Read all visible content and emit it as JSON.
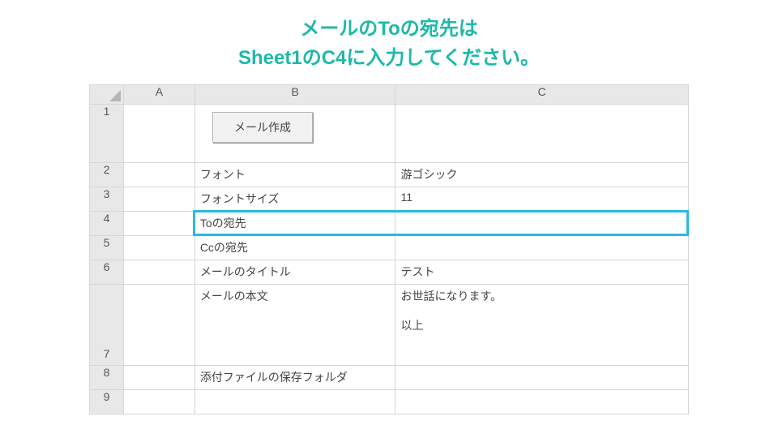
{
  "heading": {
    "line1": "メールのToの宛先は",
    "line2": "Sheet1のC4に入力してください。"
  },
  "colHeaders": {
    "A": "A",
    "B": "B",
    "C": "C"
  },
  "rowHeaders": [
    "1",
    "2",
    "3",
    "4",
    "5",
    "6",
    "7",
    "8",
    "9"
  ],
  "button": {
    "label": "メール作成"
  },
  "rows": [
    {
      "b": "",
      "c": ""
    },
    {
      "b": "フォント",
      "c": "游ゴシック"
    },
    {
      "b": "フォントサイズ",
      "c": "11"
    },
    {
      "b": "Toの宛先",
      "c": ""
    },
    {
      "b": "Ccの宛先",
      "c": ""
    },
    {
      "b": "メールのタイトル",
      "c": "テスト"
    },
    {
      "b": "メールの本文",
      "c": "お世話になります。\n\n以上"
    },
    {
      "b": "添付ファイルの保存フォルダ",
      "c": ""
    },
    {
      "b": "",
      "c": ""
    }
  ],
  "highlightRowIndex": 3
}
